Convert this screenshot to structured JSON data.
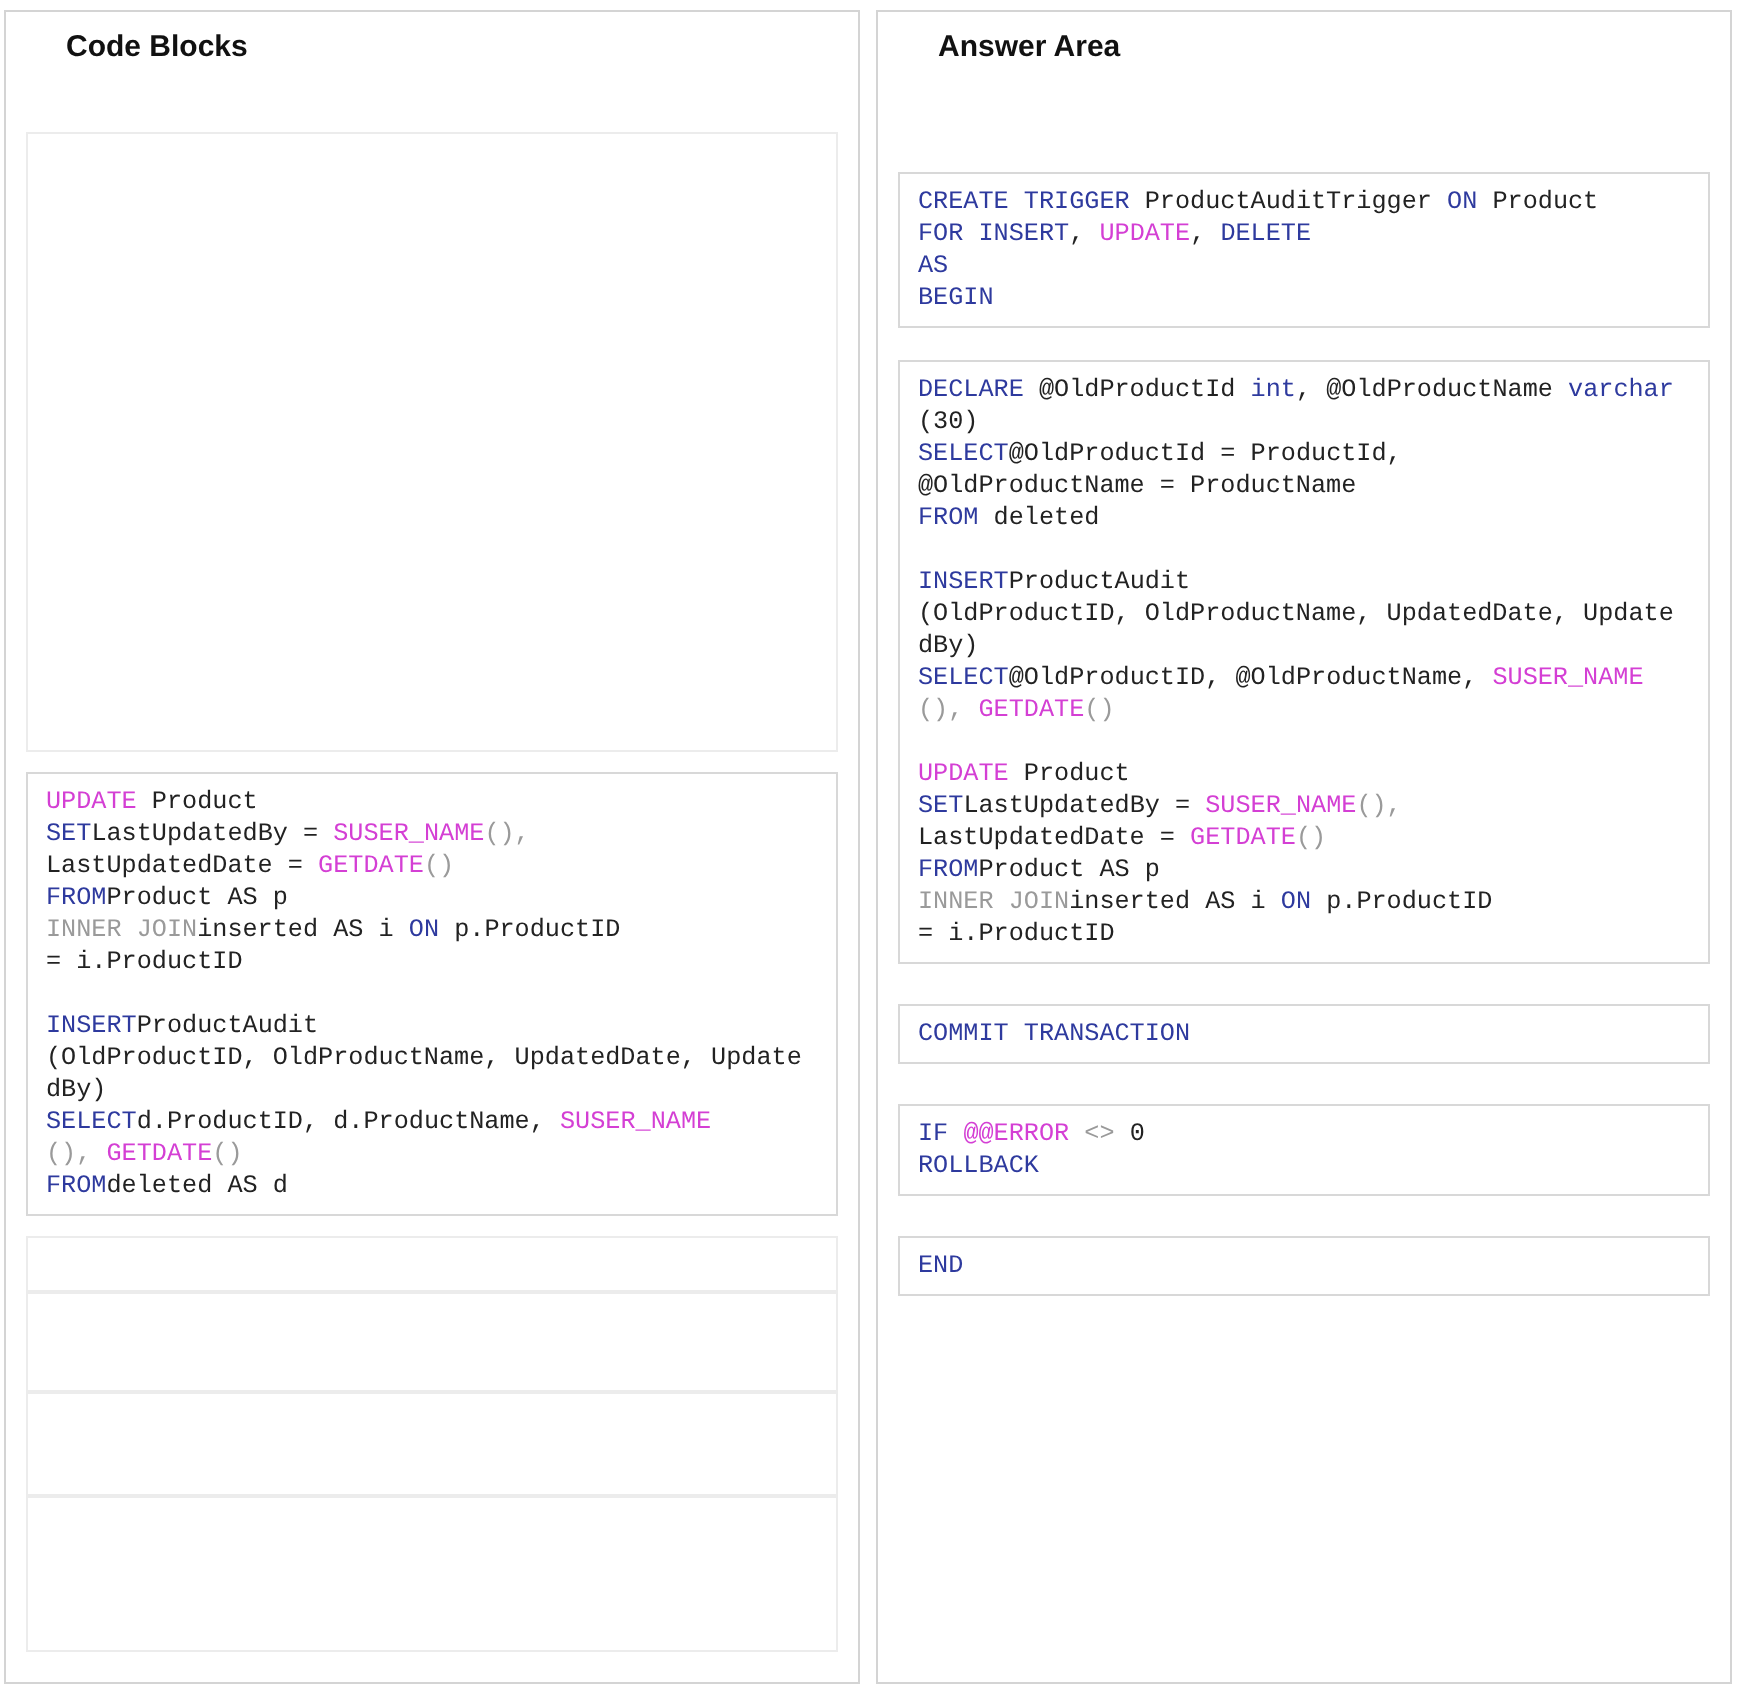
{
  "panels": [
    {
      "title": "Code Blocks",
      "slots": [
        {
          "kind": "empty"
        },
        {
          "kind": "code",
          "paragraphs": [
            [
              [
                {
                  "kind": "function",
                  "text": "UPDATE"
                },
                {
                  "kind": "plain",
                  "text": " Product"
                }
              ],
              [
                {
                  "kind": "keyword",
                  "text": "SET"
                },
                {
                  "kind": "plain",
                  "text": "LastUpdatedBy = "
                },
                {
                  "kind": "function",
                  "text": "SUSER_NAME"
                },
                {
                  "kind": "muted",
                  "text": "(),"
                }
              ],
              [
                {
                  "kind": "plain",
                  "text": "LastUpdatedDate = "
                },
                {
                  "kind": "function",
                  "text": "GETDATE"
                },
                {
                  "kind": "muted",
                  "text": "()"
                }
              ],
              [
                {
                  "kind": "keyword",
                  "text": "FROM"
                },
                {
                  "kind": "plain",
                  "text": "Product AS p"
                }
              ],
              [
                {
                  "kind": "muted",
                  "text": "INNER JOIN"
                },
                {
                  "kind": "plain",
                  "text": "inserted AS i "
                },
                {
                  "kind": "keyword",
                  "text": "ON"
                },
                {
                  "kind": "plain",
                  "text": " p.ProductID"
                }
              ],
              [
                {
                  "kind": "plain",
                  "text": "= i.ProductID"
                }
              ]
            ],
            [
              [
                {
                  "kind": "keyword",
                  "text": "INSERT"
                },
                {
                  "kind": "plain",
                  "text": "ProductAudit"
                }
              ],
              [
                {
                  "kind": "plain",
                  "text": "(OldProductID, OldProductName, UpdatedDate, Update"
                }
              ],
              [
                {
                  "kind": "plain",
                  "text": "dBy)"
                }
              ],
              [
                {
                  "kind": "keyword",
                  "text": "SELECT"
                },
                {
                  "kind": "plain",
                  "text": "d.ProductID, d.ProductName, "
                },
                {
                  "kind": "function",
                  "text": "SUSER_NAME"
                }
              ],
              [
                {
                  "kind": "muted",
                  "text": "(), "
                },
                {
                  "kind": "function",
                  "text": "GETDATE"
                },
                {
                  "kind": "muted",
                  "text": "()"
                }
              ],
              [
                {
                  "kind": "keyword",
                  "text": "FROM"
                },
                {
                  "kind": "plain",
                  "text": "deleted AS d"
                }
              ]
            ]
          ]
        },
        {
          "kind": "empty"
        },
        {
          "kind": "empty"
        },
        {
          "kind": "empty"
        },
        {
          "kind": "empty"
        }
      ]
    },
    {
      "title": "Answer Area",
      "slots": [
        {
          "kind": "code",
          "paragraphs": [
            [
              [
                {
                  "kind": "keyword",
                  "text": "CREATE TRIGGER"
                },
                {
                  "kind": "plain",
                  "text": " ProductAuditTrigger "
                },
                {
                  "kind": "keyword",
                  "text": "ON"
                },
                {
                  "kind": "plain",
                  "text": " Product"
                }
              ],
              [
                {
                  "kind": "keyword",
                  "text": "FOR INSERT"
                },
                {
                  "kind": "plain",
                  "text": ", "
                },
                {
                  "kind": "function",
                  "text": "UPDATE"
                },
                {
                  "kind": "plain",
                  "text": ", "
                },
                {
                  "kind": "keyword",
                  "text": "DELETE"
                }
              ],
              [
                {
                  "kind": "keyword",
                  "text": "AS"
                }
              ],
              [
                {
                  "kind": "keyword",
                  "text": "BEGIN"
                }
              ]
            ]
          ]
        },
        {
          "kind": "code",
          "paragraphs": [
            [
              [
                {
                  "kind": "keyword",
                  "text": "DECLARE"
                },
                {
                  "kind": "plain",
                  "text": " @OldProductId "
                },
                {
                  "kind": "keyword",
                  "text": "int"
                },
                {
                  "kind": "plain",
                  "text": ", @OldProductName "
                },
                {
                  "kind": "keyword",
                  "text": "varchar"
                }
              ],
              [
                {
                  "kind": "plain",
                  "text": "(30)"
                }
              ],
              [
                {
                  "kind": "keyword",
                  "text": "SELECT"
                },
                {
                  "kind": "plain",
                  "text": "@OldProductId = ProductId,"
                }
              ],
              [
                {
                  "kind": "plain",
                  "text": "@OldProductName = ProductName"
                }
              ],
              [
                {
                  "kind": "keyword",
                  "text": "FROM"
                },
                {
                  "kind": "plain",
                  "text": " deleted"
                }
              ]
            ],
            [
              [
                {
                  "kind": "keyword",
                  "text": "INSERT"
                },
                {
                  "kind": "plain",
                  "text": "ProductAudit"
                }
              ],
              [
                {
                  "kind": "plain",
                  "text": "(OldProductID, OldProductName, UpdatedDate, Update"
                }
              ],
              [
                {
                  "kind": "plain",
                  "text": "dBy)"
                }
              ],
              [
                {
                  "kind": "keyword",
                  "text": "SELECT"
                },
                {
                  "kind": "plain",
                  "text": "@OldProductID, @OldProductName, "
                },
                {
                  "kind": "function",
                  "text": "SUSER_NAME"
                }
              ],
              [
                {
                  "kind": "muted",
                  "text": "(), "
                },
                {
                  "kind": "function",
                  "text": "GETDATE"
                },
                {
                  "kind": "muted",
                  "text": "()"
                }
              ]
            ],
            [
              [
                {
                  "kind": "function",
                  "text": "UPDATE"
                },
                {
                  "kind": "plain",
                  "text": " Product"
                }
              ],
              [
                {
                  "kind": "keyword",
                  "text": "SET"
                },
                {
                  "kind": "plain",
                  "text": "LastUpdatedBy = "
                },
                {
                  "kind": "function",
                  "text": "SUSER_NAME"
                },
                {
                  "kind": "muted",
                  "text": "(),"
                }
              ],
              [
                {
                  "kind": "plain",
                  "text": "LastUpdatedDate = "
                },
                {
                  "kind": "function",
                  "text": "GETDATE"
                },
                {
                  "kind": "muted",
                  "text": "()"
                }
              ],
              [
                {
                  "kind": "keyword",
                  "text": "FROM"
                },
                {
                  "kind": "plain",
                  "text": "Product AS p"
                }
              ],
              [
                {
                  "kind": "muted",
                  "text": "INNER JOIN"
                },
                {
                  "kind": "plain",
                  "text": "inserted AS i "
                },
                {
                  "kind": "keyword",
                  "text": "ON"
                },
                {
                  "kind": "plain",
                  "text": " p.ProductID"
                }
              ],
              [
                {
                  "kind": "plain",
                  "text": "= i.ProductID"
                }
              ]
            ]
          ]
        },
        {
          "kind": "code",
          "paragraphs": [
            [
              [
                {
                  "kind": "keyword",
                  "text": "COMMIT TRANSACTION"
                }
              ]
            ]
          ]
        },
        {
          "kind": "code",
          "paragraphs": [
            [
              [
                {
                  "kind": "keyword",
                  "text": "IF "
                },
                {
                  "kind": "function",
                  "text": "@@ERROR"
                },
                {
                  "kind": "muted",
                  "text": " <> "
                },
                {
                  "kind": "plain",
                  "text": "0"
                }
              ],
              [
                {
                  "kind": "keyword",
                  "text": "ROLLBACK"
                }
              ]
            ]
          ]
        },
        {
          "kind": "code",
          "paragraphs": [
            [
              [
                {
                  "kind": "keyword",
                  "text": "END"
                }
              ]
            ]
          ]
        }
      ]
    }
  ]
}
